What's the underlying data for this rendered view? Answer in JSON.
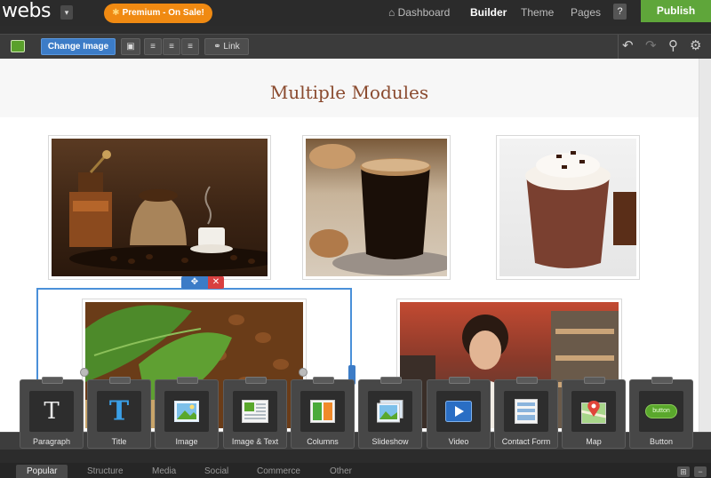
{
  "topbar": {
    "logo": "webs",
    "premium_label": "Premium - On Sale!",
    "nav": [
      "Dashboard",
      "Builder",
      "Theme",
      "Pages"
    ],
    "help": "?",
    "publish": "Publish"
  },
  "toolbar": {
    "change_image": "Change Image",
    "link": "Link"
  },
  "page": {
    "title": "Multiple Modules"
  },
  "modules": [
    {
      "label": "Paragraph",
      "icon": "paragraph-icon"
    },
    {
      "label": "Title",
      "icon": "title-icon"
    },
    {
      "label": "Image",
      "icon": "image-icon"
    },
    {
      "label": "Image & Text",
      "icon": "image-text-icon"
    },
    {
      "label": "Columns",
      "icon": "columns-icon"
    },
    {
      "label": "Slideshow",
      "icon": "slideshow-icon"
    },
    {
      "label": "Video",
      "icon": "video-icon"
    },
    {
      "label": "Contact Form",
      "icon": "contact-form-icon"
    },
    {
      "label": "Map",
      "icon": "map-icon"
    },
    {
      "label": "Button",
      "icon": "button-icon",
      "preview_text": "button"
    }
  ],
  "tabs": [
    "Popular",
    "Structure",
    "Media",
    "Social",
    "Commerce",
    "Other"
  ],
  "colors": {
    "accent_blue": "#3c7cc7",
    "publish_green": "#5fa63a",
    "premium_orange": "#f08a12",
    "title_brown": "#8a4a2e"
  }
}
